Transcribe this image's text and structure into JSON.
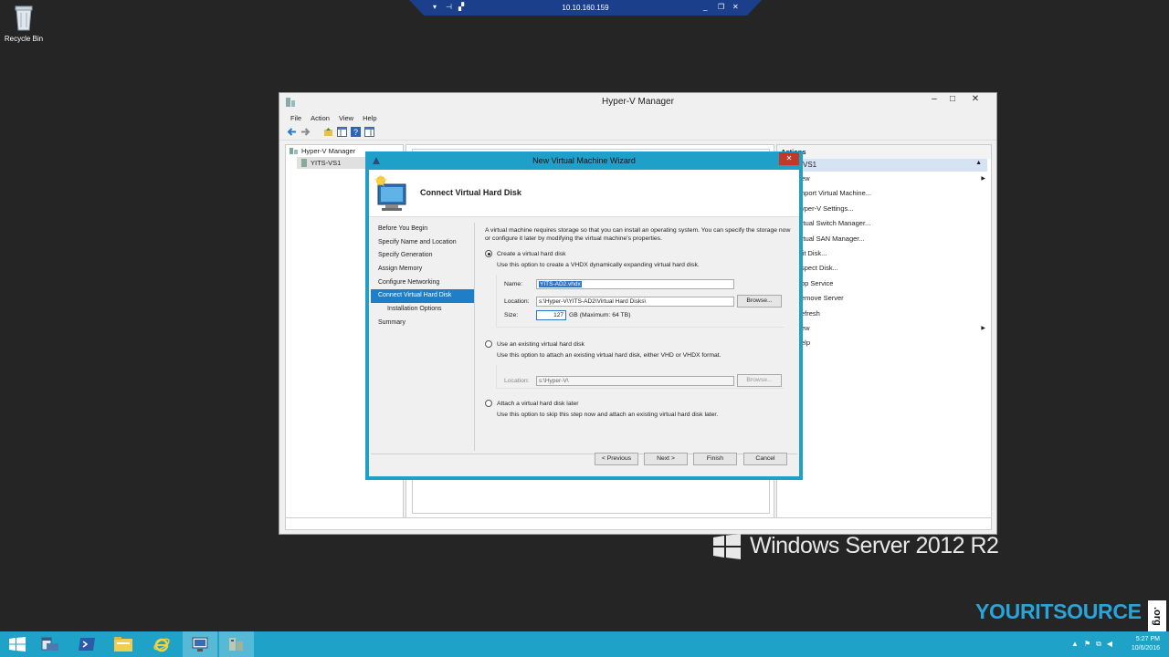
{
  "desktop": {
    "recycle_bin_label": "Recycle Bin"
  },
  "remote_bar": {
    "ip": "10.10.160.159"
  },
  "hyperv": {
    "title": "Hyper-V Manager",
    "menu": [
      "File",
      "Action",
      "View",
      "Help"
    ],
    "tree": {
      "root": "Hyper-V Manager",
      "server": "YITS-VS1"
    },
    "actions": {
      "header": "Actions",
      "group": "VS1",
      "items": [
        "ew",
        "nport Virtual Machine...",
        "yper-V Settings...",
        "rtual Switch Manager...",
        "rtual SAN Manager...",
        "lit Disk...",
        "spect Disk...",
        "op Service",
        "emove Server",
        "efresh",
        "ew",
        "elp"
      ]
    }
  },
  "wizard": {
    "title": "New Virtual Machine Wizard",
    "heading": "Connect Virtual Hard Disk",
    "steps": [
      "Before You Begin",
      "Specify Name and Location",
      "Specify Generation",
      "Assign Memory",
      "Configure Networking",
      "Connect Virtual Hard Disk",
      "Installation Options",
      "Summary"
    ],
    "intro": "A virtual machine requires storage so that you can install an operating system. You can specify the storage now or configure it later by modifying the virtual machine's properties.",
    "option_create": {
      "label": "Create a virtual hard disk",
      "desc": "Use this option to create a VHDX dynamically expanding virtual hard disk.",
      "name_label": "Name:",
      "name_value": "YITS-AD2.vhdx",
      "location_label": "Location:",
      "location_value": "s:\\Hyper-V\\YITS-AD2\\Virtual Hard Disks\\",
      "browse": "Browse...",
      "size_label": "Size:",
      "size_value": "127",
      "size_unit": "GB (Maximum: 64 TB)"
    },
    "option_existing": {
      "label": "Use an existing virtual hard disk",
      "desc": "Use this option to attach an existing virtual hard disk, either VHD or VHDX format.",
      "location_label": "Location:",
      "location_value": "s:\\Hyper-V\\",
      "browse": "Browse..."
    },
    "option_later": {
      "label": "Attach a virtual hard disk later",
      "desc": "Use this option to skip this step now and attach an existing virtual hard disk later."
    },
    "buttons": {
      "previous": "< Previous",
      "next": "Next >",
      "finish": "Finish",
      "cancel": "Cancel"
    }
  },
  "branding": {
    "windows": "Windows Server 2012 R2",
    "yis": "YOURITSOURCE",
    "yis_org": ".org"
  },
  "taskbar": {
    "time": "5:27 PM",
    "date": "10/6/2016"
  }
}
